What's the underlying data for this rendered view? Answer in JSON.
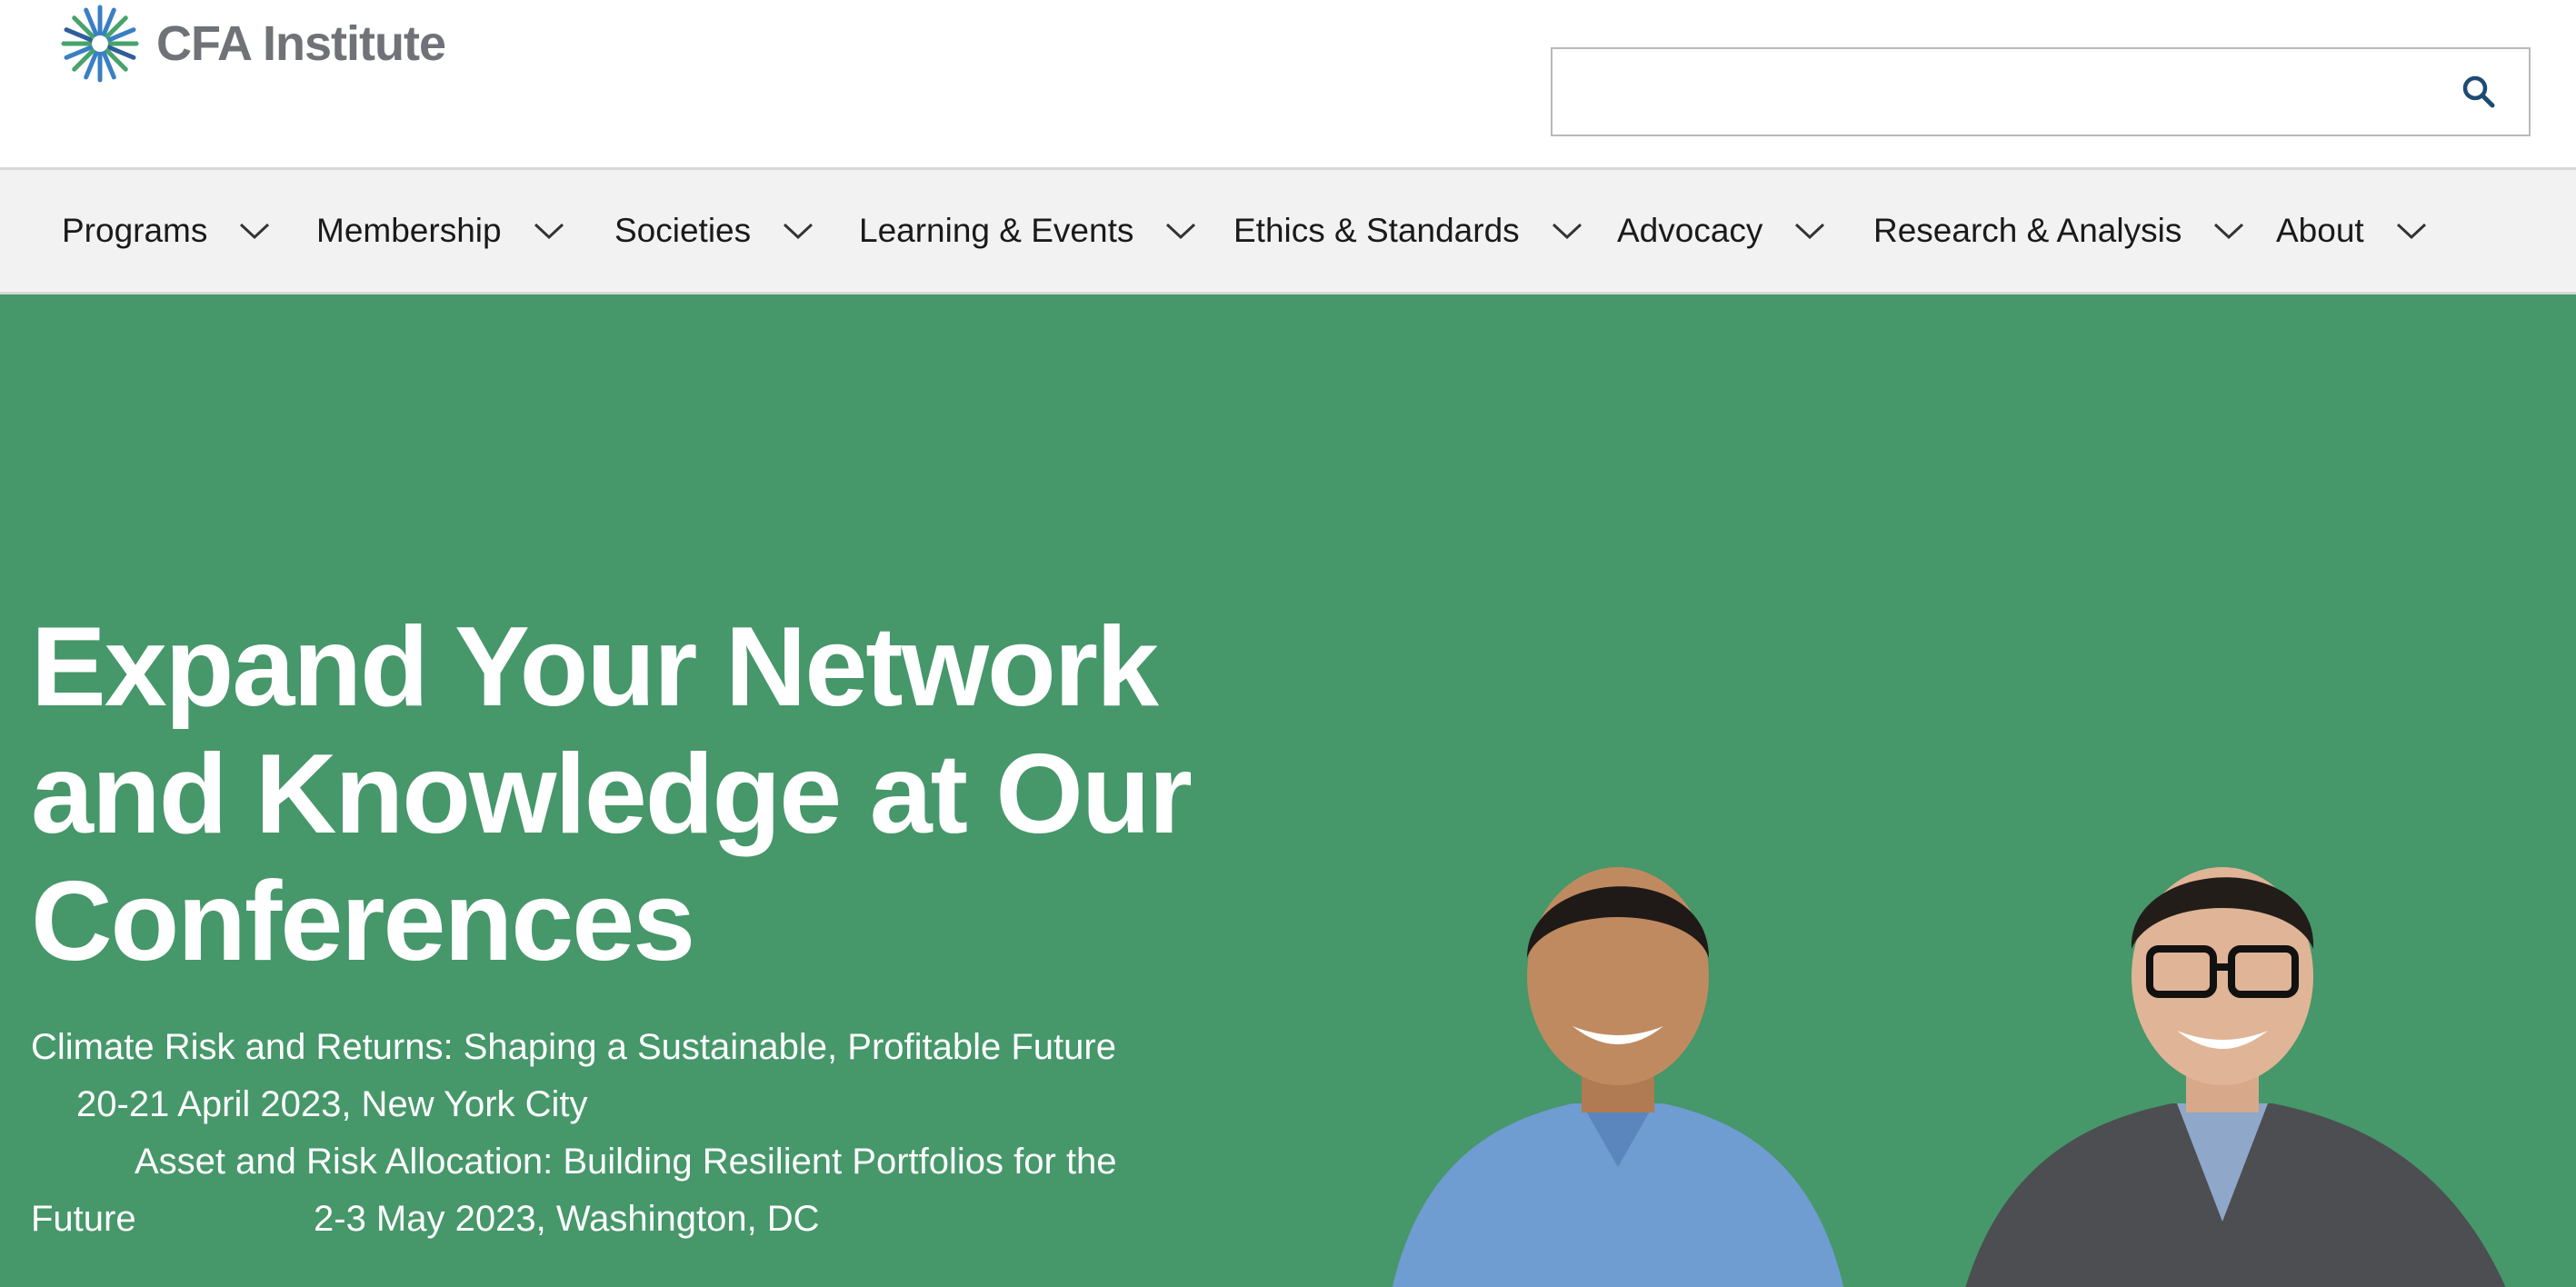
{
  "header": {
    "logo_text": "CFA Institute",
    "search": {
      "placeholder": "",
      "value": ""
    }
  },
  "nav": {
    "items": [
      {
        "label": "Programs"
      },
      {
        "label": "Membership"
      },
      {
        "label": "Societies"
      },
      {
        "label": "Learning & Events"
      },
      {
        "label": "Ethics & Standards"
      },
      {
        "label": "Advocacy"
      },
      {
        "label": "Research & Analysis"
      },
      {
        "label": "About"
      }
    ]
  },
  "hero": {
    "title": "Expand Your Network and Knowledge at Our Conferences",
    "events": [
      {
        "name": "Climate Risk and Returns: Shaping a Sustainable, Profitable Future",
        "date": "20-21 April 2023, New York City"
      },
      {
        "name_part1": "Asset and Risk Allocation: Building Resilient Portfolios for the",
        "name_part2": "Future",
        "date": "2-3 May 2023, Washington, DC"
      }
    ]
  },
  "colors": {
    "hero_green": "#46976a",
    "nav_bg": "#f2f2f2",
    "logo_gray": "#6f7277",
    "search_icon": "#1d4b73"
  },
  "icons": [
    "cfa-logo-icon",
    "search-icon",
    "chevron-down-icon"
  ]
}
